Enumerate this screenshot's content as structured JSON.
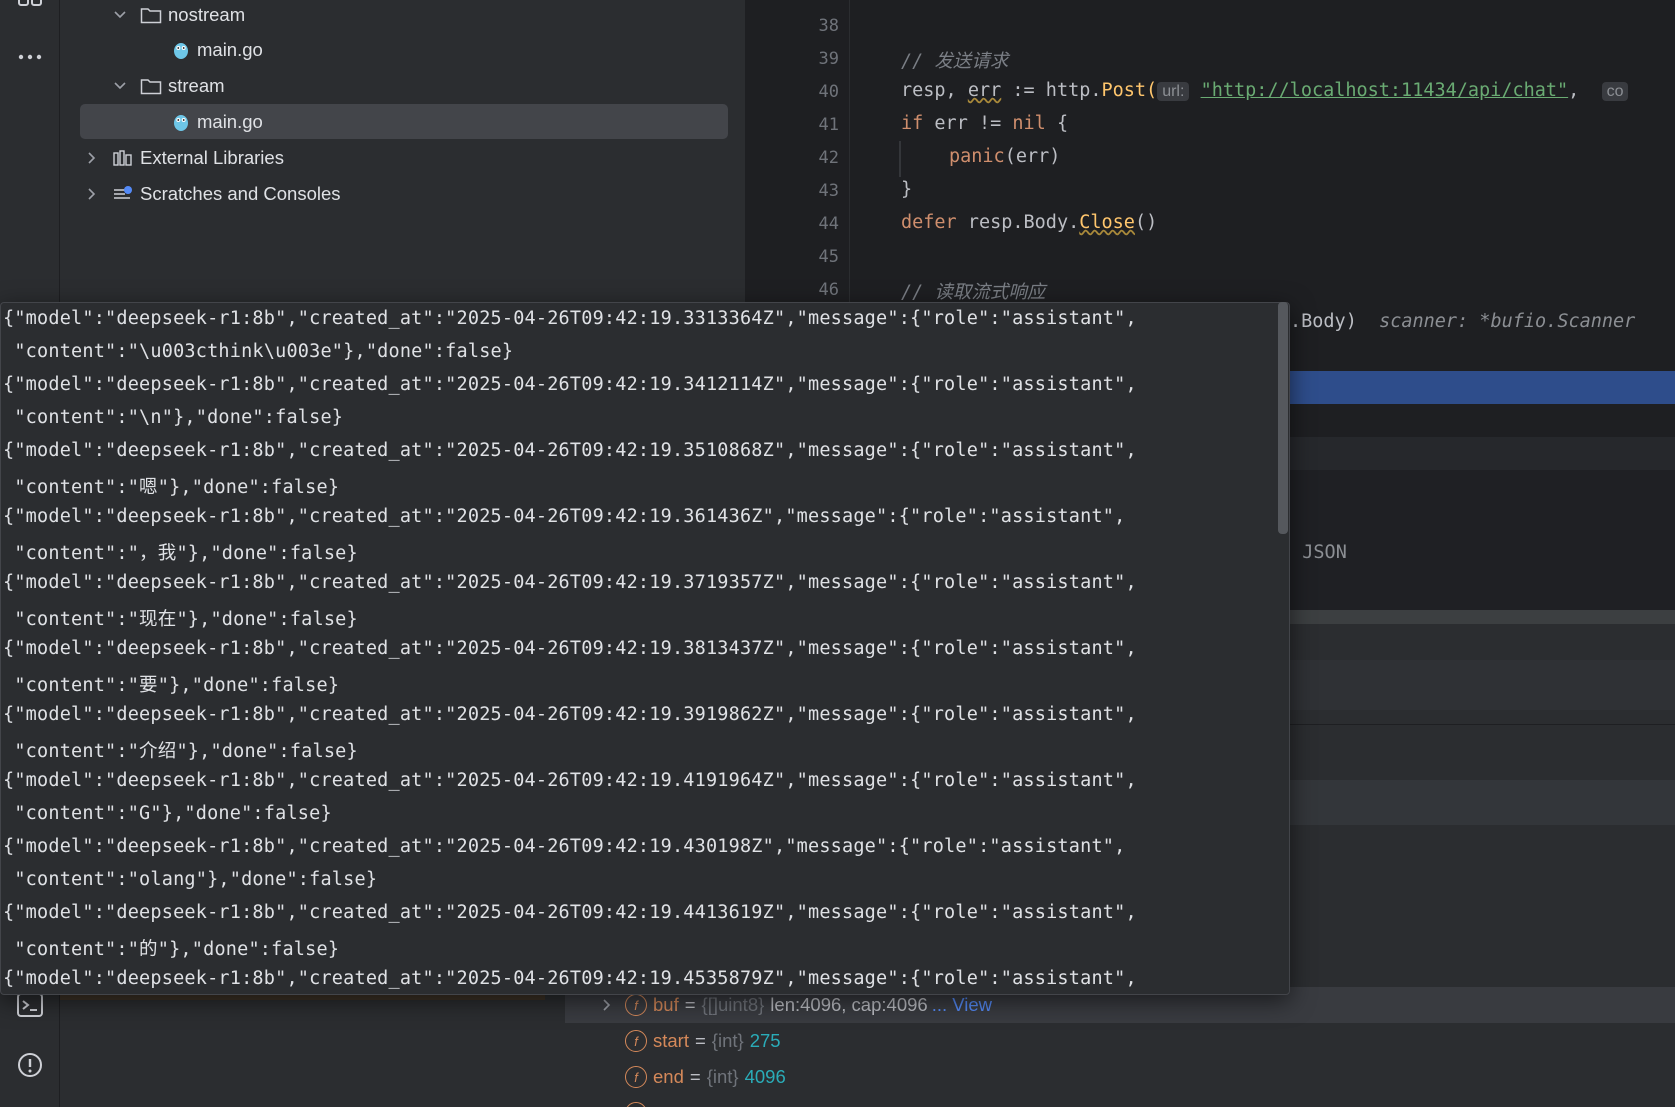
{
  "project_tree": {
    "items": [
      {
        "label": "nostream",
        "kind": "folder",
        "expanded": true
      },
      {
        "label": "main.go",
        "kind": "go-file"
      },
      {
        "label": "stream",
        "kind": "folder",
        "expanded": true
      },
      {
        "label": "main.go",
        "kind": "go-file",
        "selected": true
      },
      {
        "label": "External Libraries",
        "kind": "library",
        "expanded": false
      },
      {
        "label": "Scratches and Consoles",
        "kind": "scratches",
        "expanded": false
      }
    ]
  },
  "editor": {
    "line_numbers": [
      "38",
      "39",
      "40",
      "41",
      "42",
      "43",
      "44",
      "45",
      "46"
    ],
    "comment_send": "// 发送请求",
    "post_prefix": "resp, ",
    "post_err": "err",
    "post_assign": " := http.",
    "post_func": "Post(",
    "post_hint_url": "url:",
    "post_url": "\"http://localhost:11434/api/chat\"",
    "post_comma": ",",
    "post_hint_cut": "co",
    "if_kw": "if",
    "if_cond": " err != ",
    "if_nil": "nil",
    "if_brace": " {",
    "panic_call": "panic",
    "panic_args": "(err)",
    "close_brace": "}",
    "defer_kw": "defer",
    "defer_expr": " resp.Body.",
    "defer_close": "Close",
    "defer_parens": "()",
    "comment_read": "// 读取流式响应",
    "scanner_tail": ".Body)",
    "scanner_inline": "scanner: *bufio.Scanner",
    "json_tail": "˜ JSON"
  },
  "debug_vars": [
    {
      "name": "buf",
      "type": "{[]uint8}",
      "value": "len:4096, cap:4096",
      "more": "... View",
      "expandable": true
    },
    {
      "name": "start",
      "type": "{int}",
      "value": "275"
    },
    {
      "name": "end",
      "type": "{int}",
      "value": "4096"
    }
  ],
  "popup": {
    "lines": [
      "{\"model\":\"deepseek-r1:8b\",\"created_at\":\"2025-04-26T09:42:19.3313364Z\",\"message\":{\"role\":\"assistant\",",
      " \"content\":\"\\u003cthink\\u003e\"},\"done\":false}",
      "{\"model\":\"deepseek-r1:8b\",\"created_at\":\"2025-04-26T09:42:19.3412114Z\",\"message\":{\"role\":\"assistant\",",
      " \"content\":\"\\n\"},\"done\":false}",
      "{\"model\":\"deepseek-r1:8b\",\"created_at\":\"2025-04-26T09:42:19.3510868Z\",\"message\":{\"role\":\"assistant\",",
      " \"content\":\"嗯\"},\"done\":false}",
      "{\"model\":\"deepseek-r1:8b\",\"created_at\":\"2025-04-26T09:42:19.361436Z\",\"message\":{\"role\":\"assistant\",",
      " \"content\":\"，我\"},\"done\":false}",
      "{\"model\":\"deepseek-r1:8b\",\"created_at\":\"2025-04-26T09:42:19.3719357Z\",\"message\":{\"role\":\"assistant\",",
      " \"content\":\"现在\"},\"done\":false}",
      "{\"model\":\"deepseek-r1:8b\",\"created_at\":\"2025-04-26T09:42:19.3813437Z\",\"message\":{\"role\":\"assistant\",",
      " \"content\":\"要\"},\"done\":false}",
      "{\"model\":\"deepseek-r1:8b\",\"created_at\":\"2025-04-26T09:42:19.3919862Z\",\"message\":{\"role\":\"assistant\",",
      " \"content\":\"介绍\"},\"done\":false}",
      "{\"model\":\"deepseek-r1:8b\",\"created_at\":\"2025-04-26T09:42:19.4191964Z\",\"message\":{\"role\":\"assistant\",",
      " \"content\":\"G\"},\"done\":false}",
      "{\"model\":\"deepseek-r1:8b\",\"created_at\":\"2025-04-26T09:42:19.430198Z\",\"message\":{\"role\":\"assistant\",",
      " \"content\":\"olang\"},\"done\":false}",
      "{\"model\":\"deepseek-r1:8b\",\"created_at\":\"2025-04-26T09:42:19.4413619Z\",\"message\":{\"role\":\"assistant\",",
      " \"content\":\"的\"},\"done\":false}",
      "{\"model\":\"deepseek-r1:8b\",\"created_at\":\"2025-04-26T09:42:19.4535879Z\",\"message\":{\"role\":\"assistant\","
    ]
  },
  "colors": {
    "background": "#1e1f22",
    "panel": "#2b2d30",
    "selection": "#43454a",
    "execution_line": "#2e4d8b",
    "keyword": "#cf8e6d",
    "string": "#6aab73",
    "number": "#2aacb8",
    "field": "#d5895a",
    "link": "#548af7"
  }
}
